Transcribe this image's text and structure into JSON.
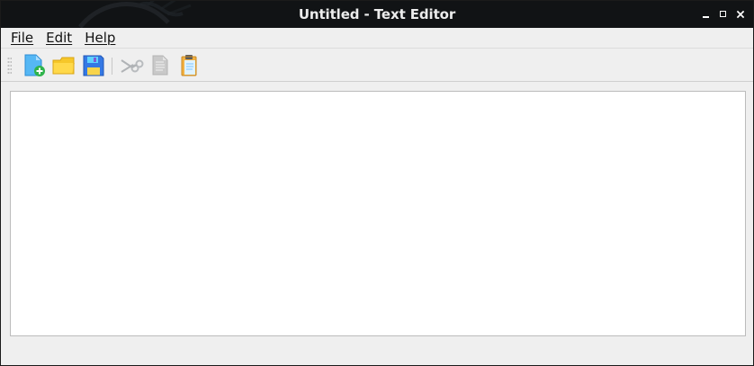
{
  "window": {
    "title": "Untitled - Text Editor",
    "controls": {
      "minimize": "minimize",
      "maximize": "maximize",
      "close": "close"
    }
  },
  "menu": {
    "items": [
      {
        "label": "File"
      },
      {
        "label": "Edit"
      },
      {
        "label": "Help"
      }
    ]
  },
  "toolbar": {
    "icons": [
      {
        "name": "new-document-icon",
        "enabled": true
      },
      {
        "name": "open-folder-icon",
        "enabled": true
      },
      {
        "name": "save-disk-icon",
        "enabled": true
      },
      {
        "name": "cut-scissors-icon",
        "enabled": false
      },
      {
        "name": "copy-document-icon",
        "enabled": false
      },
      {
        "name": "paste-clipboard-icon",
        "enabled": true
      }
    ]
  },
  "editor": {
    "value": ""
  },
  "colors": {
    "titlebar": "#111315",
    "window_bg": "#efefef",
    "editor_bg": "#ffffff",
    "accent_blue": "#2f7fe8",
    "accent_yellow": "#f5c52f",
    "accent_green": "#33b34a"
  }
}
